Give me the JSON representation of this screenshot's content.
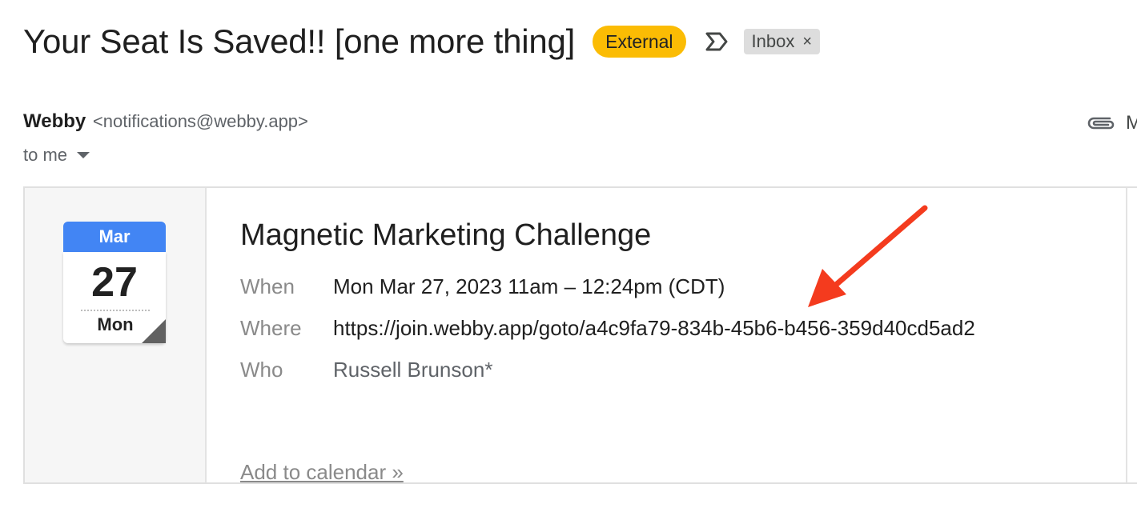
{
  "email": {
    "subject": "Your Seat Is Saved!! [one more thing]",
    "labels": {
      "external": "External",
      "inbox": "Inbox",
      "remove_symbol": "×"
    },
    "sender": {
      "name": "Webby",
      "email": "<notifications@webby.app>"
    },
    "recipient": "to me",
    "attachment_text": "M"
  },
  "event": {
    "calendar": {
      "month": "Mar",
      "day": "27",
      "weekday": "Mon",
      "accent_color": "#4285f4"
    },
    "title": "Magnetic Marketing Challenge",
    "details": [
      {
        "label": "When",
        "value": "Mon Mar 27, 2023 11am – 12:24pm (CDT)"
      },
      {
        "label": "Where",
        "value": "https://join.webby.app/goto/a4c9fa79-834b-45b6-b456-359d40cd5ad2"
      },
      {
        "label": "Who",
        "value": "Russell Brunson*"
      }
    ],
    "add_to_calendar": "Add to calendar »"
  },
  "colors": {
    "external_badge": "#fbbc04",
    "annotation_arrow": "#f43b1e"
  },
  "icons": [
    "importance-marker-icon",
    "remove-label-icon",
    "recipient-dropdown-icon",
    "attachment-icon",
    "annotation-arrow-icon"
  ]
}
